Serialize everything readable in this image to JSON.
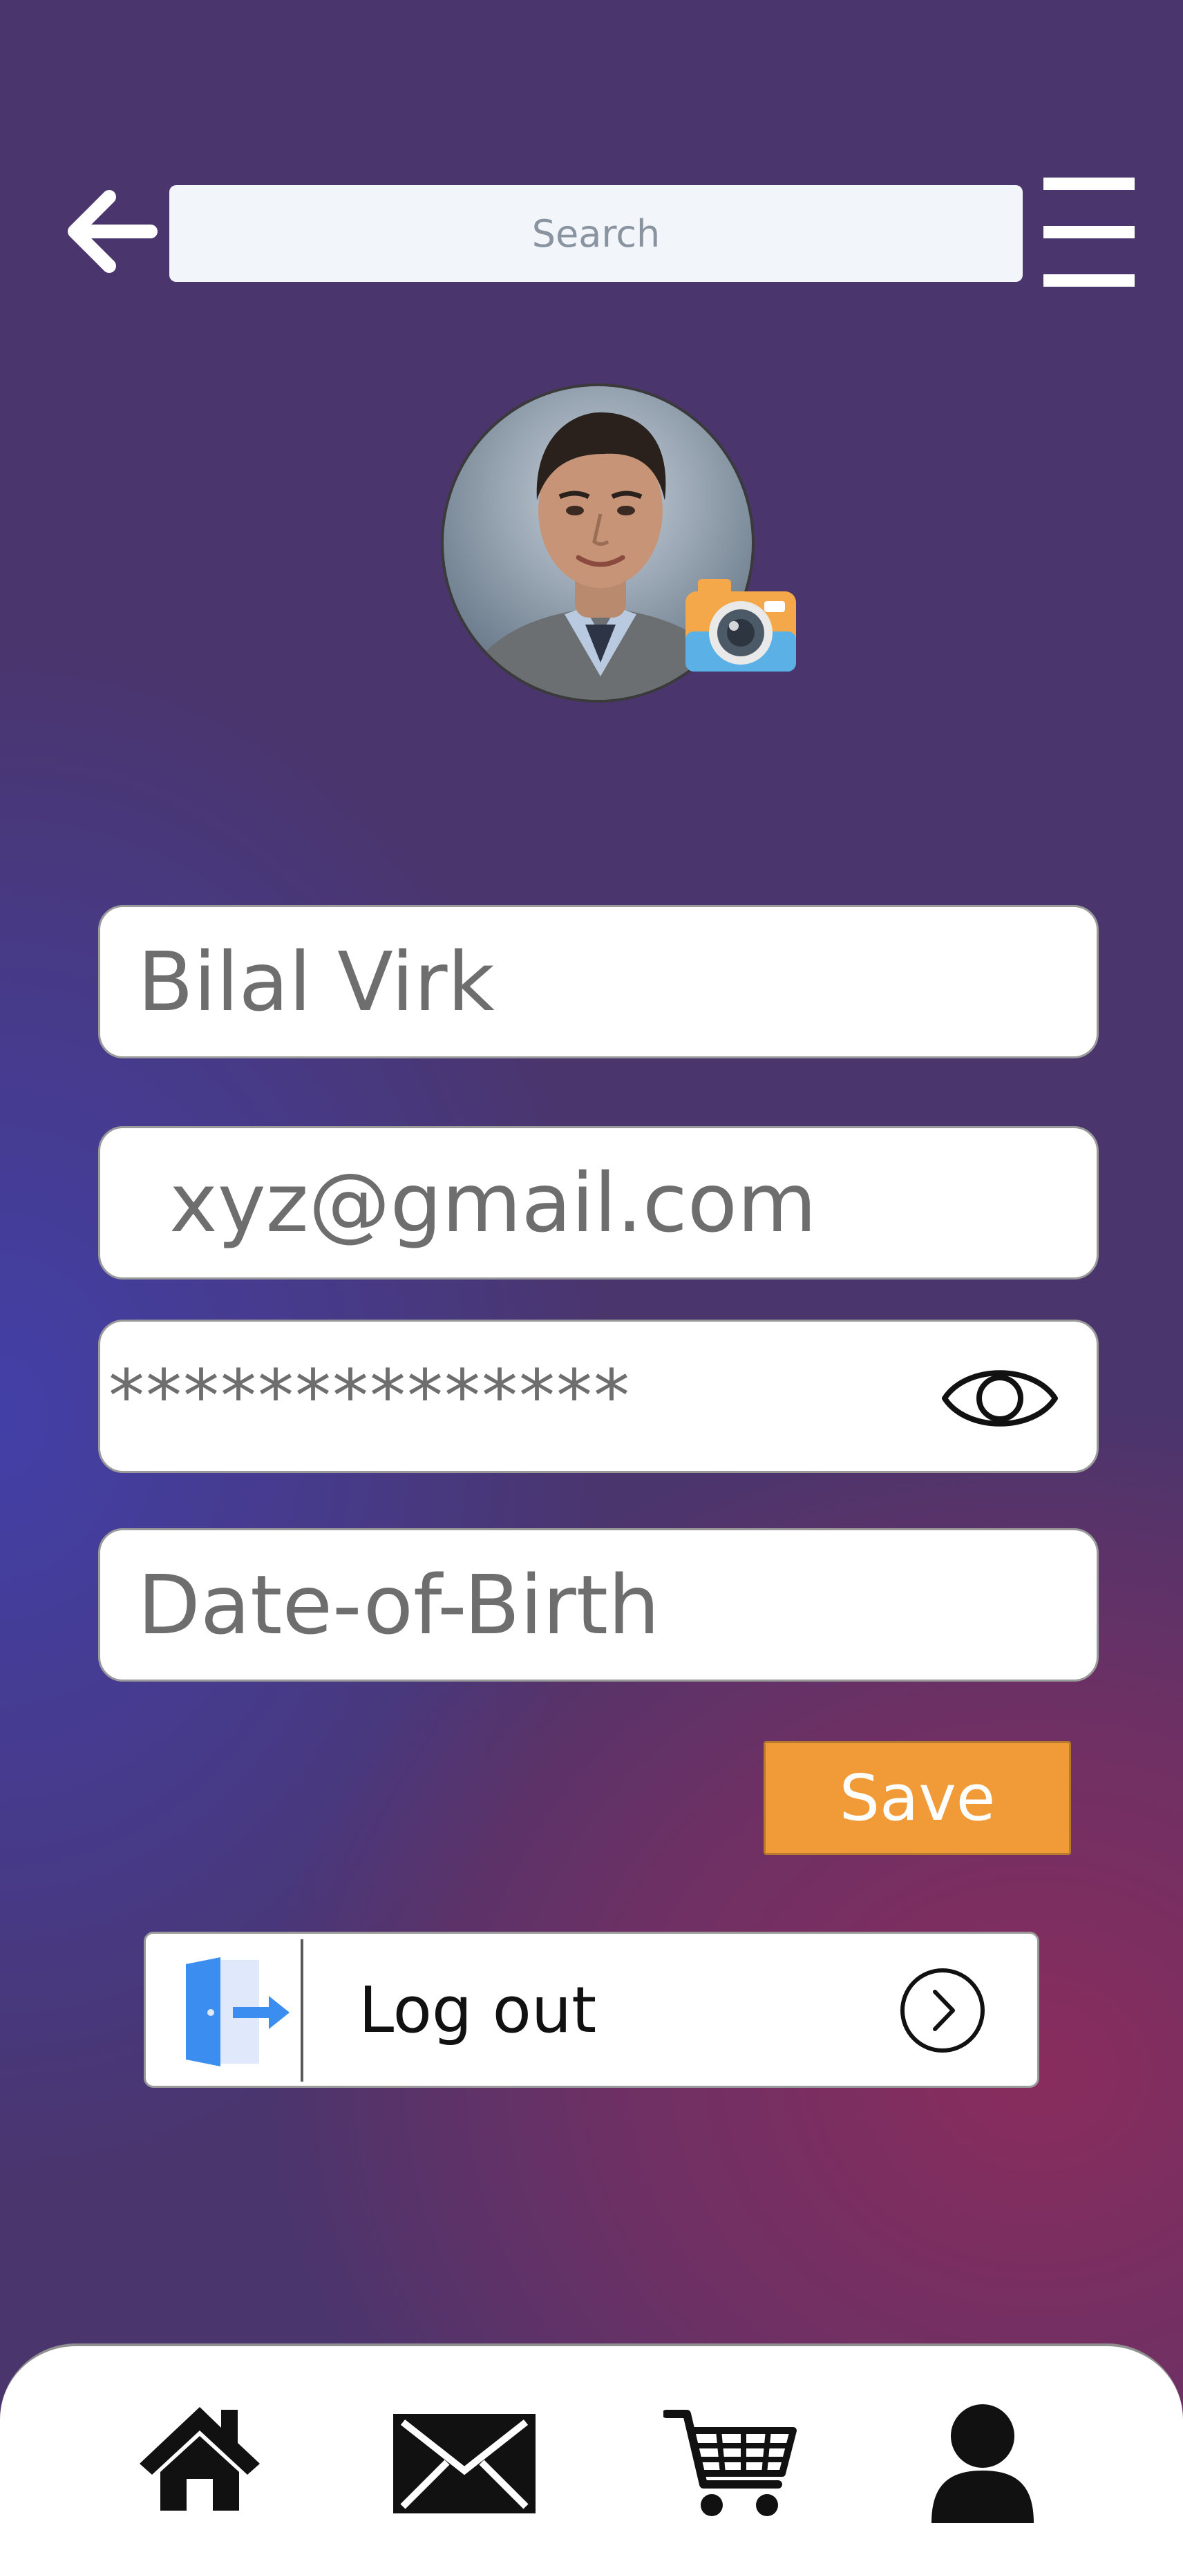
{
  "header": {
    "search_placeholder": "Search",
    "back_icon": "arrow-left-icon",
    "menu_icon": "hamburger-menu-icon"
  },
  "profile": {
    "avatar_alt": "Profile photo",
    "camera_icon": "camera-icon"
  },
  "form": {
    "name_value": "Bilal Virk",
    "email_value": "xyz@gmail.com",
    "password_value": "**************",
    "password_toggle_icon": "eye-icon",
    "dob_placeholder": "Date-of-Birth",
    "save_label": "Save"
  },
  "logout": {
    "label": "Log out",
    "icon": "door-exit-icon",
    "arrow_icon": "chevron-right-circle-icon"
  },
  "bottom_nav": {
    "items": [
      {
        "icon": "home-icon"
      },
      {
        "icon": "mail-icon"
      },
      {
        "icon": "cart-icon"
      },
      {
        "icon": "user-icon"
      }
    ]
  },
  "colors": {
    "background_base": "#4a356d",
    "background_blue": "#4240aa",
    "background_magenta": "#8c2c5c",
    "save_button": "#f19b38",
    "field_background": "#ffffff",
    "search_background": "#f2f5f9",
    "logout_icon_blue": "#3b8df0"
  }
}
